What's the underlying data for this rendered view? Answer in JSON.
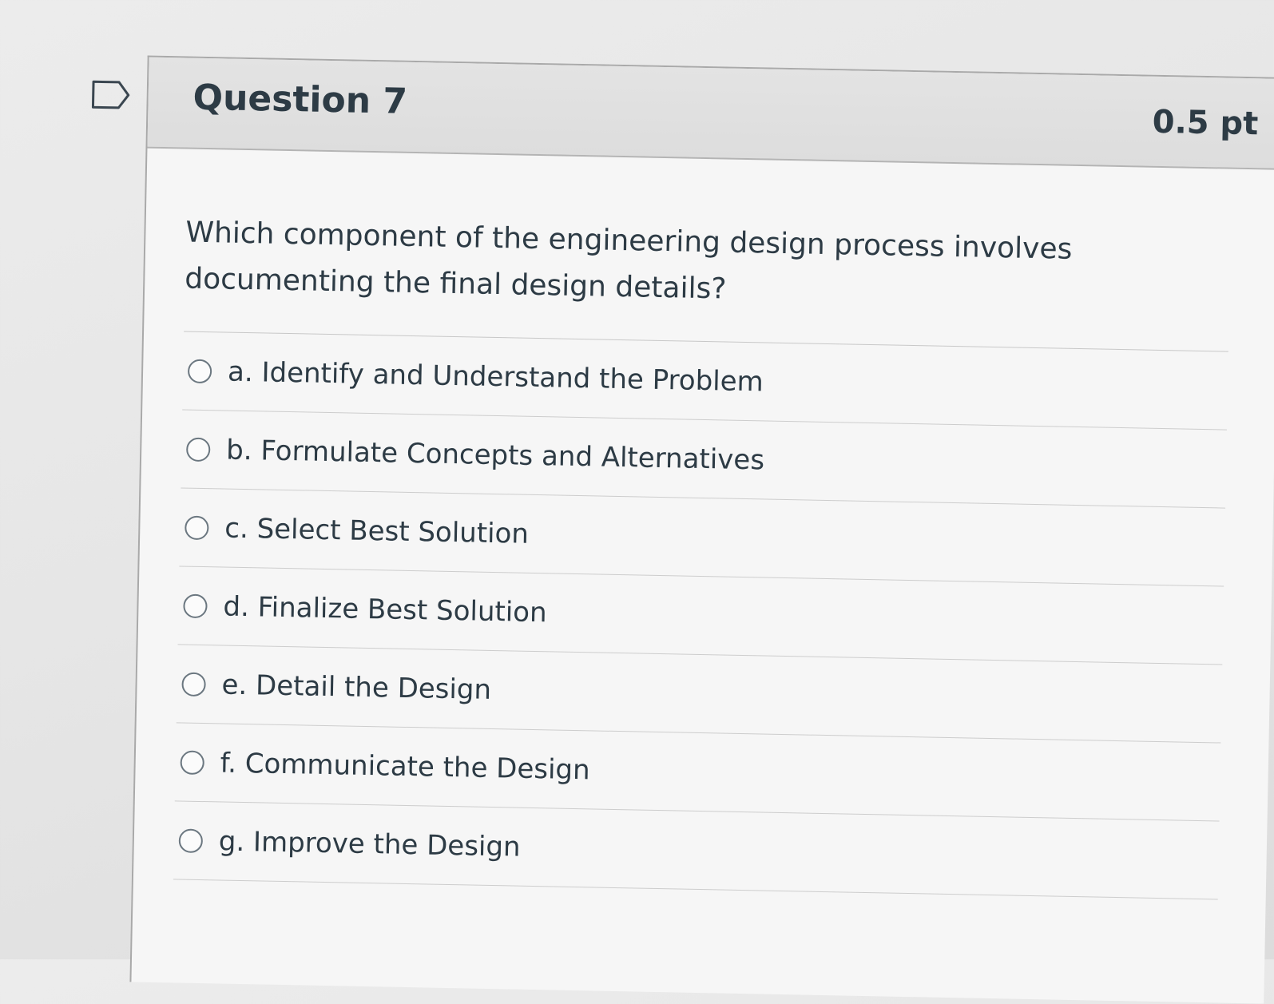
{
  "question": {
    "title": "Question 7",
    "points": "0.5 pt",
    "text": "Which component of the engineering design process involves documenting the final design details?",
    "answers": [
      {
        "label": "a. Identify and Understand the Problem",
        "selected": false
      },
      {
        "label": "b. Formulate Concepts and Alternatives",
        "selected": false
      },
      {
        "label": "c. Select Best Solution",
        "selected": false
      },
      {
        "label": "d. Finalize Best Solution",
        "selected": false
      },
      {
        "label": "e. Detail the Design",
        "selected": false
      },
      {
        "label": "f. Communicate the Design",
        "selected": false
      },
      {
        "label": "g. Improve the Design",
        "selected": false
      }
    ]
  },
  "icons": {
    "flag": "flag-question-icon"
  },
  "colors": {
    "text": "#2d3b45",
    "header_bg": "#e0e0e0",
    "body_bg": "#f6f6f6",
    "border": "#a9a9a9"
  }
}
